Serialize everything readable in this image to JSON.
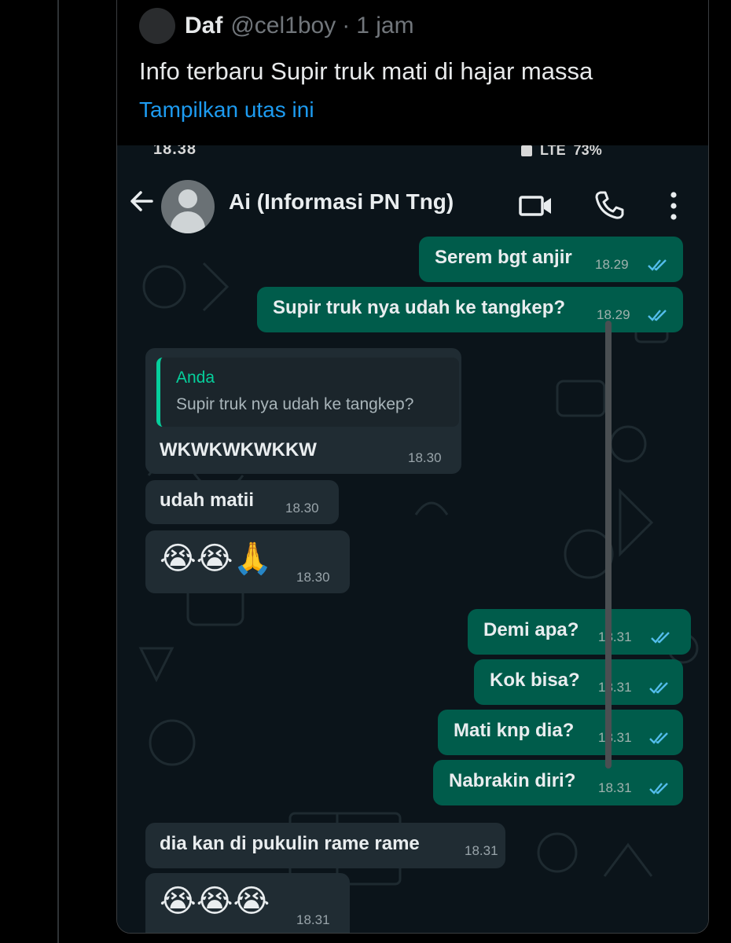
{
  "tweet": {
    "author_name": "Daf",
    "author_handle": "@cel1boy",
    "separator": "·",
    "time_ago": "1 jam",
    "text": "Info terbaru Supir truk mati di hajar massa",
    "thread_link": "Tampilkan utas ini"
  },
  "phone": {
    "status_time": "18.38",
    "status_right": "LTE",
    "battery": "73%"
  },
  "chat": {
    "contact_name": "Ai (Informasi PN Tng)",
    "messages": [
      {
        "dir": "out",
        "text": "Serem bgt anjir",
        "time": "18.29"
      },
      {
        "dir": "out",
        "text": "Supir truk nya udah ke tangkep?",
        "time": "18.29"
      },
      {
        "dir": "in",
        "quote_name": "Anda",
        "quote_text": "Supir truk nya udah ke tangkep?",
        "text": "WKWKWKWKKW",
        "time": "18.30"
      },
      {
        "dir": "in",
        "text": "udah matii",
        "time": "18.30"
      },
      {
        "dir": "in",
        "emoji": "😭😭🙏",
        "time": "18.30"
      },
      {
        "dir": "out",
        "text": "Demi apa?",
        "time": "18.31"
      },
      {
        "dir": "out",
        "text": "Kok bisa?",
        "time": "18.31"
      },
      {
        "dir": "out",
        "text": "Mati knp dia?",
        "time": "18.31"
      },
      {
        "dir": "out",
        "text": "Nabrakin diri?",
        "time": "18.31"
      },
      {
        "dir": "in",
        "text": "dia kan di pukulin rame rame",
        "time": "18.31"
      },
      {
        "dir": "in",
        "emoji": "😭😭😭",
        "time": "18.31"
      }
    ]
  },
  "colors": {
    "outgoing_bubble": "#005c4b",
    "incoming_bubble": "#202c33",
    "chat_background": "#0b141a",
    "link": "#1d9bf0",
    "read_ticks": "#53bdeb",
    "quote_accent": "#06cf9c"
  },
  "icons": [
    "back-arrow-icon",
    "video-call-icon",
    "phone-call-icon",
    "more-options-icon",
    "double-check-icon"
  ]
}
